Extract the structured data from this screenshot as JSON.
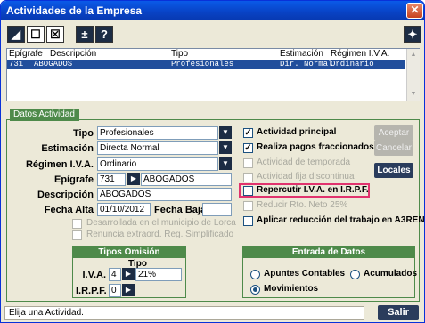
{
  "window": {
    "title": "Actividades de la Empresa"
  },
  "toolbar": {
    "buttons": [
      {
        "name": "edit",
        "glyph": "◢"
      },
      {
        "name": "new",
        "glyph": "☐"
      },
      {
        "name": "delete",
        "glyph": "☒"
      },
      {
        "name": "plusminus",
        "glyph": "±"
      },
      {
        "name": "help",
        "glyph": "?"
      }
    ],
    "wand_glyph": "✦"
  },
  "grid": {
    "headers": [
      "Epígrafe",
      "Descripción",
      "Tipo",
      "Estimación",
      "Régimen I.V.A."
    ],
    "row": [
      "731",
      "ABOGADOS",
      "Profesionales",
      "Dir. Normal",
      "Ordinario"
    ]
  },
  "tab_label": "Datos Actividad",
  "form": {
    "tipo_label": "Tipo",
    "tipo_value": "Profesionales",
    "estimacion_label": "Estimación",
    "estimacion_value": "Directa Normal",
    "regimen_label": "Régimen I.V.A.",
    "regimen_value": "Ordinario",
    "epigrafe_label": "Epígrafe",
    "epigrafe_code": "731",
    "epigrafe_desc": "ABOGADOS",
    "descripcion_label": "Descripción",
    "descripcion_value": "ABOGADOS",
    "fecha_alta_label": "Fecha Alta",
    "fecha_alta_value": "01/10/2012",
    "fecha_baja_label": "Fecha Baja",
    "fecha_baja_value": "",
    "lorca_label": "Desarrollada en el municipio de Lorca",
    "renuncia_label": "Renuncia extraord. Reg. Simplificado"
  },
  "checks": {
    "actividad_principal": "Actividad principal",
    "pagos_fraccionados": "Realiza pagos fraccionados",
    "temporada": "Actividad de temporada",
    "fija_discontinua": "Actividad fija discontinua",
    "repercutir": "Repercutir I.V.A. en I.R.P.F.",
    "reducir": "Reducir Rto. Neto 25%",
    "aplicar": "Aplicar reducción del trabajo en A3REN"
  },
  "side_buttons": {
    "aceptar": "Aceptar",
    "cancelar": "Cancelar",
    "locales": "Locales"
  },
  "tipos_omision": {
    "title": "Tipos Omisión",
    "tipo_header": "Tipo",
    "iva_label": "I.V.A.",
    "iva_code": "4",
    "iva_value": "21%",
    "irpf_label": "I.R.P.F.",
    "irpf_code": "0",
    "irpf_value": ""
  },
  "entrada": {
    "title": "Entrada de Datos",
    "apuntes": "Apuntes Contables",
    "acumulados": "Acumulados",
    "movimientos": "Movimientos"
  },
  "status": {
    "text": "Elija una Actividad.",
    "exit": "Salir"
  }
}
